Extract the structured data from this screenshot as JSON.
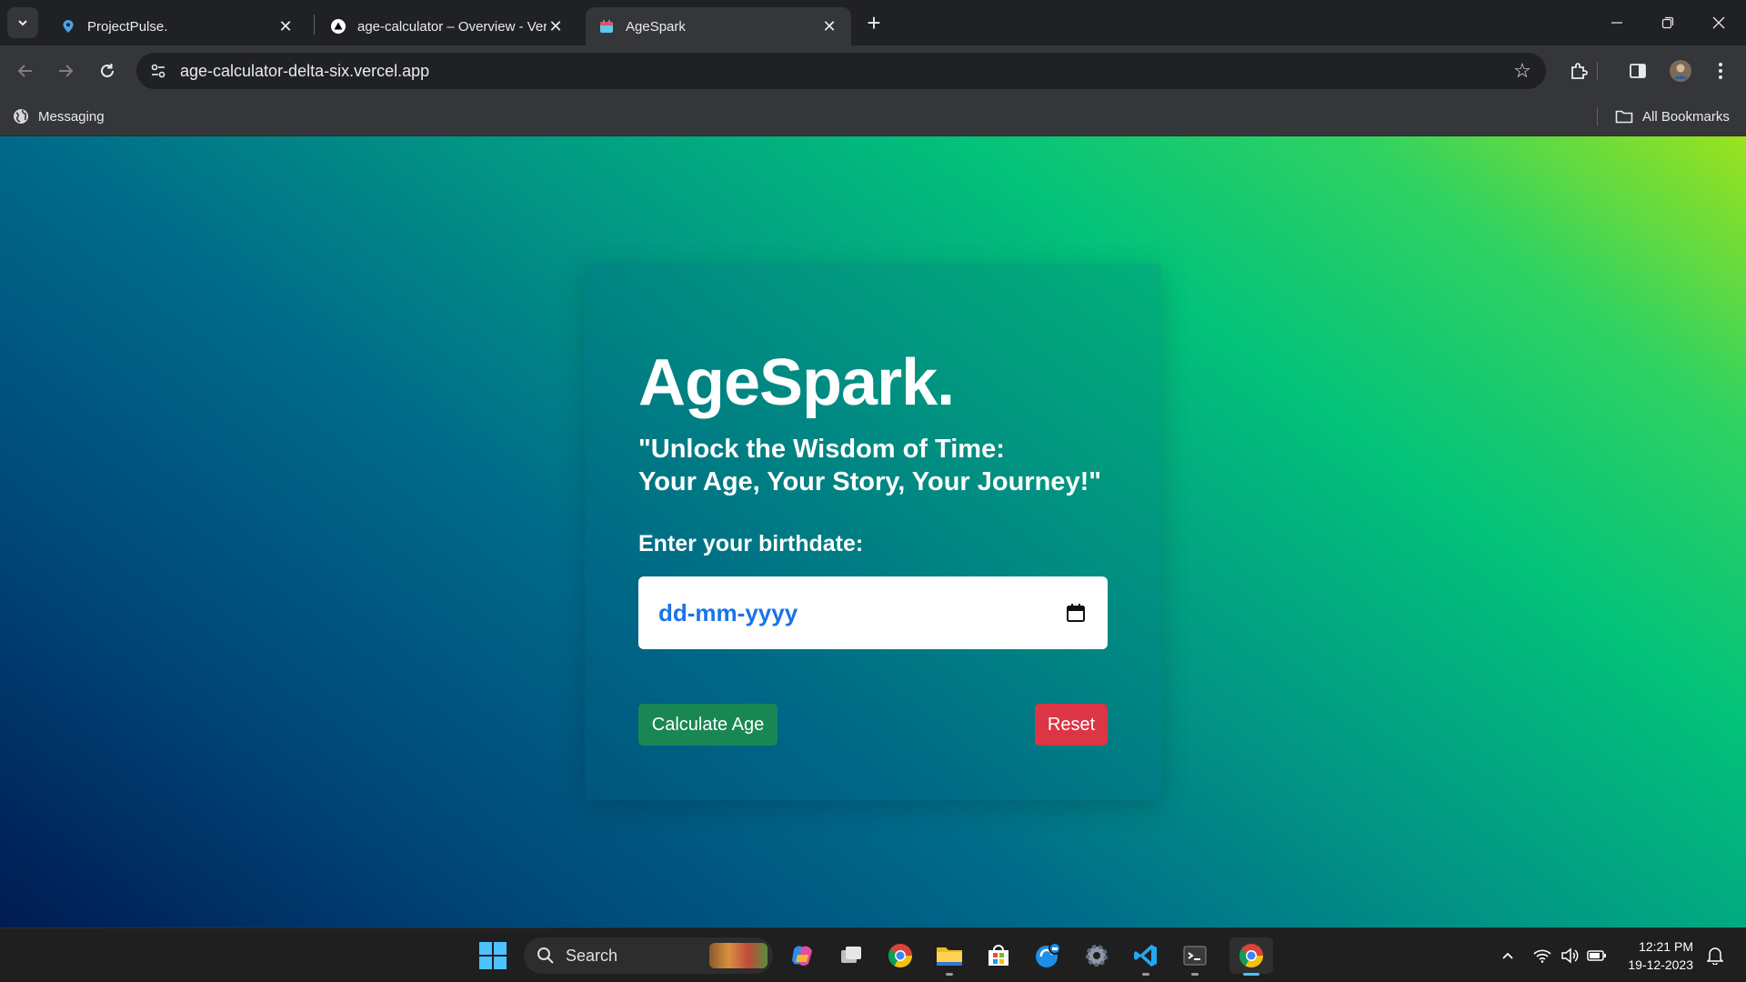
{
  "browser": {
    "tabs": [
      {
        "title": "ProjectPulse.",
        "icon": "location-pin-icon",
        "active": false
      },
      {
        "title": "age-calculator – Overview - Vercel",
        "icon": "vercel-triangle-icon",
        "active": false
      },
      {
        "title": "AgeSpark",
        "icon": "calendar-favicon",
        "active": true
      }
    ],
    "url": "age-calculator-delta-six.vercel.app",
    "bookmarks": [
      {
        "label": "Messaging",
        "icon": "globe-icon"
      }
    ],
    "all_bookmarks_label": "All Bookmarks"
  },
  "app": {
    "title": "AgeSpark.",
    "tagline_line1": "\"Unlock the Wisdom of Time:",
    "tagline_line2": "Your Age, Your Story, Your Journey!\"",
    "field_label": "Enter your birthdate:",
    "date_placeholder": "dd-mm-yyyy",
    "calculate_label": "Calculate Age",
    "reset_label": "Reset",
    "colors": {
      "calculate": "#198754",
      "reset": "#dc3545",
      "placeholder": "#1a73e8"
    }
  },
  "taskbar": {
    "search_label": "Search",
    "apps": [
      "copilot-icon",
      "task-view-icon",
      "chrome-icon",
      "file-explorer-icon",
      "microsoft-store-icon",
      "edge-dev-icon",
      "settings-icon",
      "vscode-icon",
      "terminal-icon",
      "chrome-icon"
    ],
    "time": "12:21 PM",
    "date": "19-12-2023"
  }
}
